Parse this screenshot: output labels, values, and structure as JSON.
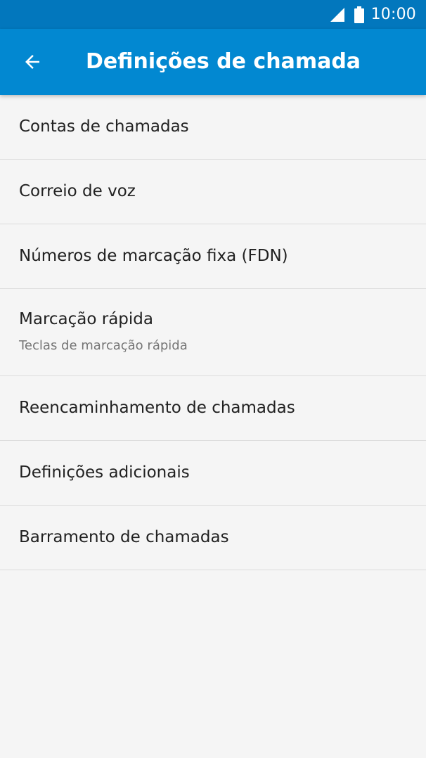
{
  "status_bar": {
    "time": "10:00",
    "icons": [
      "signal-icon",
      "battery-icon"
    ],
    "color": "#0277bd"
  },
  "app_bar": {
    "back_icon": "arrow-back-icon",
    "title": "Definições de chamada",
    "color": "#0288d1"
  },
  "settings": {
    "items": [
      {
        "title": "Contas de chamadas"
      },
      {
        "title": "Correio de voz"
      },
      {
        "title": "Números de marcação fixa (FDN)"
      },
      {
        "title": "Marcação rápida",
        "subtitle": "Teclas de marcação rápida"
      },
      {
        "title": "Reencaminhamento de chamadas"
      },
      {
        "title": "Definições adicionais"
      },
      {
        "title": "Barramento de chamadas"
      }
    ]
  }
}
